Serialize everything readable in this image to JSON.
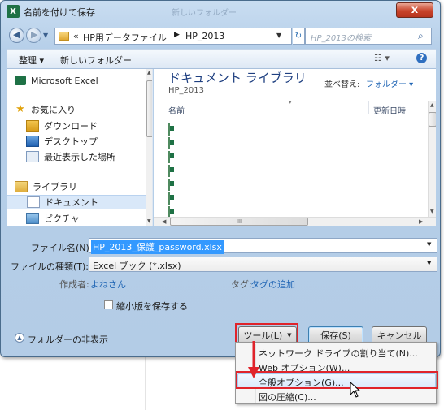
{
  "window": {
    "title": "名前を付けて保存",
    "app_icon": "excel-icon",
    "close_glyph": "x",
    "background_title": "新しいフォルダー"
  },
  "address": {
    "prefix": "«",
    "path": [
      "HP用データファイル",
      "HP_2013"
    ],
    "search_placeholder": "HP_2013の検索"
  },
  "toolbar": {
    "organize": "整理 ▾",
    "new_folder": "新しいフォルダー"
  },
  "nav": {
    "items": [
      {
        "label": "Microsoft Excel",
        "icon": "excel-icon"
      },
      {
        "label": "お気に入り",
        "icon": "star-icon"
      },
      {
        "label": "ダウンロード",
        "icon": "download-icon"
      },
      {
        "label": "デスクトップ",
        "icon": "desktop-icon"
      },
      {
        "label": "最近表示した場所",
        "icon": "recent-places-icon"
      },
      {
        "label": "ライブラリ",
        "icon": "library-icon"
      },
      {
        "label": "ドキュメント",
        "icon": "documents-icon"
      },
      {
        "label": "ピクチャ",
        "icon": "pictures-icon"
      }
    ]
  },
  "content": {
    "library_title": "ドキュメント ライブラリ",
    "library_sub": "HP_2013",
    "arrange_label": "並べ替え:",
    "arrange_value": "フォルダー ▾",
    "col_name": "名前",
    "col_date": "更新日時",
    "files": [
      "",
      "",
      "",
      "",
      "",
      "",
      "",
      ""
    ],
    "scroll_h_thumb": "III"
  },
  "form": {
    "filename_label": "ファイル名(N):",
    "filename_value": "HP_2013_保護_password.xlsx",
    "filetype_label": "ファイルの種類(T):",
    "filetype_value": "Excel ブック (*.xlsx)",
    "author_label": "作成者:",
    "author_value": "よねさん",
    "tags_label": "タグ:",
    "tags_value": "タグの追加",
    "thumbnail_label": "縮小版を保存する",
    "hide_folders": "フォルダーの非表示"
  },
  "buttons": {
    "tools": "ツール(L)",
    "save": "保存(S)",
    "cancel": "キャンセル"
  },
  "tools_menu": {
    "items": [
      "ネットワーク ドライブの割り当て(N)...",
      "Web オプション(W)...",
      "全般オプション(G)...",
      "図の圧縮(C)..."
    ],
    "highlighted_index": 2
  },
  "colors": {
    "highlight": "#e0242b",
    "accent_blue": "#1e64b4",
    "excel_green": "#1e7145"
  }
}
